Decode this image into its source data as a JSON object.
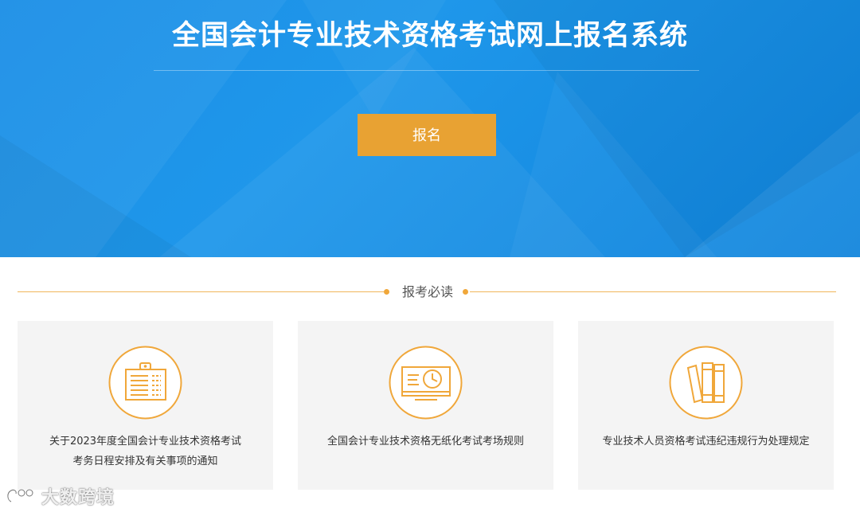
{
  "hero": {
    "title": "全国会计专业技术资格考试网上报名系统",
    "register_label": "报名"
  },
  "section": {
    "title": "报考必读"
  },
  "cards": [
    {
      "line1": "关于2023年度全国会计专业技术资格考试",
      "line2": "考务日程安排及有关事项的通知",
      "icon": "clipboard-icon"
    },
    {
      "line1": "全国会计专业技术资格无纸化考试考场规则",
      "line2": "",
      "icon": "computer-clock-icon"
    },
    {
      "line1": "专业技术人员资格考试违纪违规行为处理规定",
      "line2": "",
      "icon": "books-icon"
    }
  ],
  "watermark": {
    "text": "大数跨境",
    "icon": "logo-icon"
  },
  "colors": {
    "hero_blue": "#1a8ee6",
    "accent_orange": "#e8a233",
    "card_bg": "#f4f4f4",
    "icon_orange": "#f0a73a"
  }
}
